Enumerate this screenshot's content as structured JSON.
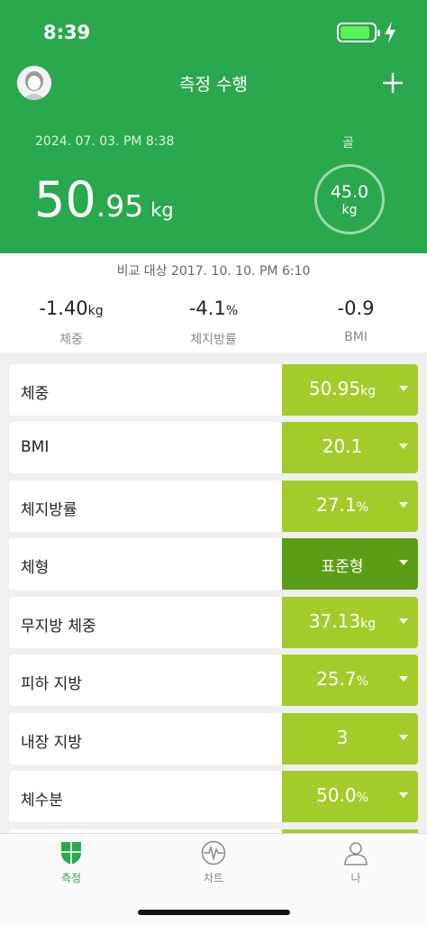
{
  "status_bar": {
    "time": "8:39"
  },
  "header": {
    "title": "측정 수행",
    "measure_date": "2024. 07. 03. PM 8:38",
    "weight_integer": "50",
    "weight_fraction": ".95",
    "weight_unit": "kg",
    "goal_label": "골",
    "goal_value": "45.0",
    "goal_unit": "kg"
  },
  "comparison": {
    "date": "비교 대상 2017. 10. 10. PM 6:10",
    "deltas": [
      {
        "value": "-1.40",
        "unit": "kg",
        "label": "체중"
      },
      {
        "value": "-4.1",
        "unit": "%",
        "label": "체지방률"
      },
      {
        "value": "-0.9",
        "unit": "",
        "label": "BMI"
      }
    ]
  },
  "metrics": [
    {
      "name": "체중",
      "value": "50.95",
      "unit": "kg"
    },
    {
      "name": "BMI",
      "value": "20.1",
      "unit": ""
    },
    {
      "name": "체지방률",
      "value": "27.1",
      "unit": "%"
    },
    {
      "name": "체형",
      "value": "표준형",
      "unit": ""
    },
    {
      "name": "무지방 체중",
      "value": "37.13",
      "unit": "kg"
    },
    {
      "name": "피하 지방",
      "value": "25.7",
      "unit": "%"
    },
    {
      "name": "내장 지방",
      "value": "3",
      "unit": ""
    },
    {
      "name": "체수분",
      "value": "50.0",
      "unit": "%"
    }
  ],
  "tabs": [
    {
      "label": "측정",
      "icon": "shield-icon",
      "active": true
    },
    {
      "label": "차트",
      "icon": "pulse-icon",
      "active": false
    },
    {
      "label": "나",
      "icon": "person-icon",
      "active": false
    }
  ],
  "colors": {
    "header_green": "#2aa84d",
    "metric_lime": "#a3cc2a",
    "body_type_green": "#5a9e16"
  }
}
